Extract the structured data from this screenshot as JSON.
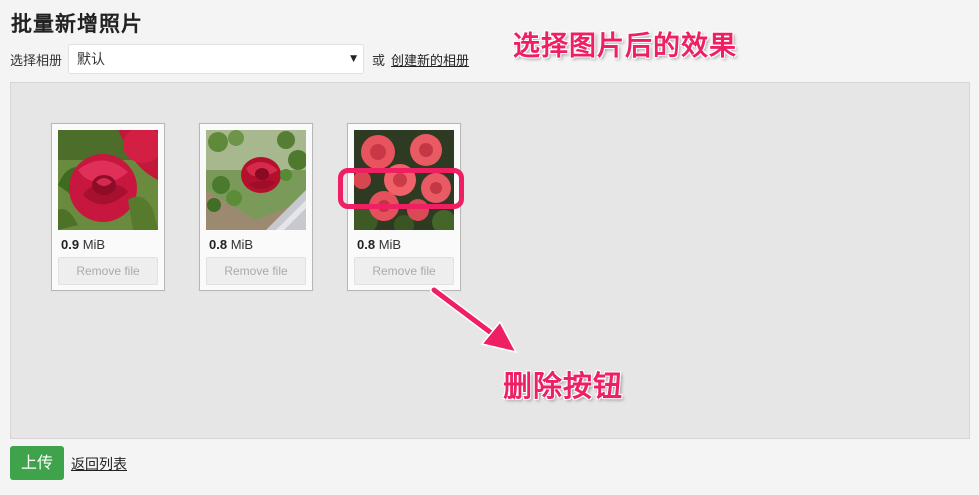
{
  "page_title": "批量新增照片",
  "album": {
    "label": "选择相册",
    "selected": "默认",
    "caret": "▼",
    "or_text": "或",
    "create_link": "创建新的相册"
  },
  "files": [
    {
      "size_value": "0.9",
      "size_unit": "MiB",
      "remove_label": "Remove file",
      "image": "red-rose-closeup"
    },
    {
      "size_value": "0.8",
      "size_unit": "MiB",
      "remove_label": "Remove file",
      "image": "red-rose-bush"
    },
    {
      "size_value": "0.8",
      "size_unit": "MiB",
      "remove_label": "Remove file",
      "image": "pink-roses-cluster"
    }
  ],
  "annotations": {
    "top_note": "选择图片后的效果",
    "delete_note": "删除按钮",
    "color": "#ee1f63"
  },
  "footer": {
    "upload_label": "上传",
    "back_link": "返回列表"
  },
  "colors": {
    "upload_button": "#3ea34a",
    "dropzone_bg": "#e6e6e6"
  }
}
